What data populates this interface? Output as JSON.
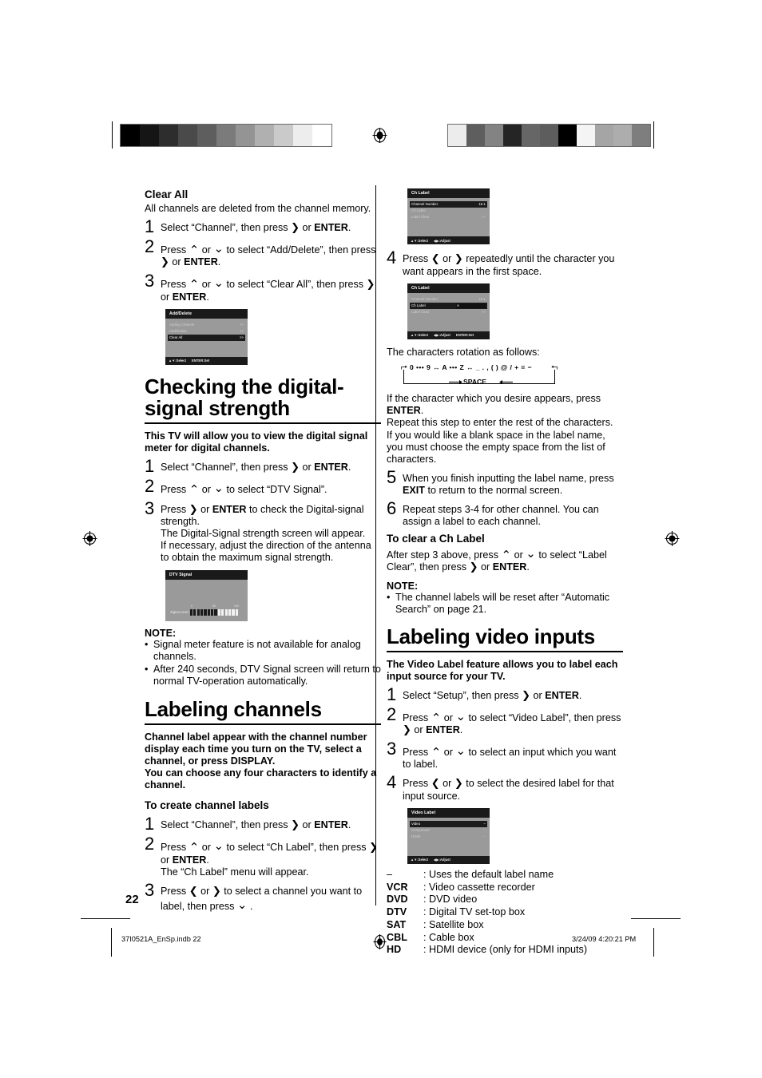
{
  "page": {
    "number": "22",
    "footer_file": "37I0521A_EnSp.indb   22",
    "footer_date": "3/24/09   4:20:21 PM"
  },
  "left_column": {
    "clear_all": {
      "heading": "Clear All",
      "intro": "All channels are deleted from the channel memory.",
      "steps": [
        {
          "num": "1",
          "html": "Select “Channel”, then press <span class=\"gl gl-r\"></span> or <b>ENTER</b>."
        },
        {
          "num": "2",
          "html": "Press <span class=\"gl gl-u\"></span> or <span class=\"gl gl-d\"></span> to select “Add/Delete”, then press <span class=\"gl gl-r\"></span> or <b>ENTER</b>."
        },
        {
          "num": "3",
          "html": "Press <span class=\"gl gl-u\"></span> or <span class=\"gl gl-d\"></span> to select “Clear All”, then press <span class=\"gl gl-r\"></span> or <b>ENTER</b>."
        }
      ],
      "osd": {
        "title": "Add/Delete",
        "rows": [
          {
            "label": "Adding Channel",
            "value": ">>",
            "highlight": false
          },
          {
            "label": "Add/Delete",
            "value": ">>",
            "highlight": false
          },
          {
            "label": "Clear All",
            "value": ">>",
            "highlight": true
          }
        ],
        "footer": [
          "▲▼:Select",
          "ENTER:Set"
        ]
      }
    },
    "signal_section": {
      "title": "Checking the digital-signal strength",
      "intro": "This TV will allow you to view the digital signal meter for digital channels.",
      "steps": [
        {
          "num": "1",
          "html": "Select “Channel”, then press <span class=\"gl gl-r\"></span> or <b>ENTER</b>."
        },
        {
          "num": "2",
          "html": "Press <span class=\"gl gl-u\"></span> or <span class=\"gl gl-d\"></span> to select “DTV Signal”."
        },
        {
          "num": "3",
          "html": "Press <span class=\"gl gl-r\"></span> or <b>ENTER</b> to check the Digital-signal strength.<br>The Digital-Signal strength screen will appear.<br>If necessary, adjust the direction of the antenna to obtain the maximum signal strength."
        }
      ],
      "osd": {
        "title": "DTV Signal",
        "signal_label": "Signal Level",
        "scale": [
          "0",
          "50",
          "100"
        ],
        "bars_total": 14,
        "bars_on": 6
      },
      "note_title": "NOTE:",
      "notes": [
        "Signal meter feature is not available for analog channels.",
        "After 240 seconds, DTV Signal screen will return to normal TV-operation automatically."
      ]
    },
    "labeling_channels": {
      "title": "Labeling channels",
      "intro1": "Channel label appear with the channel number display each time you turn on the TV, select a channel, or press DISPLAY.",
      "intro2": "You can choose any four characters to identify a channel.",
      "sub_heading": "To create channel labels",
      "steps": [
        {
          "num": "1",
          "html": "Select “Channel”, then press <span class=\"gl gl-r\"></span> or <b>ENTER</b>."
        },
        {
          "num": "2",
          "html": "Press <span class=\"gl gl-u\"></span> or <span class=\"gl gl-d\"></span> to select “Ch Label”, then press <span class=\"gl gl-r\"></span> or <b>ENTER</b>.<br>The “Ch Label” menu will appear."
        },
        {
          "num": "3",
          "html": "Press <span class=\"gl gl-l\"></span> or <span class=\"gl gl-r\"></span> to select a channel you want to label, then press <span class=\"gl gl-d\"></span> ."
        }
      ]
    }
  },
  "right_column": {
    "osd_ch_label_1": {
      "title": "Ch Label",
      "rows": [
        {
          "label": "Channel Number",
          "value": "15-1",
          "highlight": true
        },
        {
          "label": "Ch Label",
          "value": "",
          "highlight": false
        },
        {
          "label": "Label Clear",
          "value": ">>",
          "highlight": false
        }
      ],
      "footer": [
        "▲▼:Select",
        "◀▶:Adjust"
      ]
    },
    "step4": {
      "num": "4",
      "html": "Press <span class=\"gl gl-l\"></span> or <span class=\"gl gl-r\"></span> repeatedly until the character you want appears in the first space."
    },
    "osd_ch_label_2": {
      "title": "Ch Label",
      "rows": [
        {
          "label": "Channel Number",
          "value": "15-1",
          "highlight": false
        },
        {
          "label": "Ch Label",
          "value": "A",
          "highlight": true,
          "field": true
        },
        {
          "label": "Label Clear",
          "value": ">>",
          "highlight": false
        }
      ],
      "footer": [
        "▲▼:Select",
        "◀▶:Adjust",
        "ENTER:Set"
      ]
    },
    "rotation_caption": "The characters rotation as follows:",
    "rotation": {
      "line1": "0 ••• 9 ↔ A ••• Z ↔ _ . , ( ) @ / + = −",
      "line2": "SPACE"
    },
    "after_rotation": [
      "If the character which you desire appears, press <b>ENTER</b>.",
      "Repeat this step to enter the rest of the characters.",
      "If you would like a blank space in the label name, you must choose the empty space from the list of characters."
    ],
    "steps_56": [
      {
        "num": "5",
        "html": "When you finish inputting the label name, press <b>EXIT</b> to return to the normal screen."
      },
      {
        "num": "6",
        "html": "Repeat steps 3-4 for other channel. You can assign a label to each channel."
      }
    ],
    "clear_ch_label": {
      "heading": "To clear a Ch Label",
      "text": "After step 3 above, press <span class=\"gl gl-u\"></span> or <span class=\"gl gl-d\"></span> to select “Label Clear”, then press <span class=\"gl gl-r\"></span> or <b>ENTER</b>."
    },
    "note_title": "NOTE:",
    "notes": [
      "The channel labels will be reset after “Automatic Search” on page 21."
    ],
    "labeling_video": {
      "title": "Labeling video inputs",
      "intro": "The Video Label feature allows you to label each input source for your TV.",
      "steps": [
        {
          "num": "1",
          "html": "Select “Setup”, then press <span class=\"gl gl-r\"></span> or <b>ENTER</b>."
        },
        {
          "num": "2",
          "html": "Press <span class=\"gl gl-u\"></span> or <span class=\"gl gl-d\"></span> to select “Video Label”, then press <span class=\"gl gl-r\"></span> or <b>ENTER</b>."
        },
        {
          "num": "3",
          "html": "Press <span class=\"gl gl-u\"></span> or <span class=\"gl gl-d\"></span> to select an input which you want to label."
        },
        {
          "num": "4",
          "html": "Press <span class=\"gl gl-l\"></span> or <span class=\"gl gl-r\"></span> to select the desired label for that input source."
        }
      ],
      "osd": {
        "title": "Video Label",
        "rows": [
          {
            "label": "Video",
            "value": "–",
            "highlight": true
          },
          {
            "label": "Component",
            "value": "–",
            "highlight": false
          },
          {
            "label": "HDMI",
            "value": "–",
            "highlight": false
          }
        ],
        "footer": [
          "▲▼:Select",
          "◀▶:Adjust"
        ]
      },
      "legend": [
        {
          "key": "–",
          "dash": true,
          "value": ": Uses the default label name"
        },
        {
          "key": "VCR",
          "dash": false,
          "value": ": Video cassette recorder"
        },
        {
          "key": "DVD",
          "dash": false,
          "value": ": DVD video"
        },
        {
          "key": "DTV",
          "dash": false,
          "value": ": Digital TV set-top box"
        },
        {
          "key": "SAT",
          "dash": false,
          "value": ": Satellite box"
        },
        {
          "key": "CBL",
          "dash": false,
          "value": ": Cable box"
        },
        {
          "key": "HD",
          "dash": false,
          "value": ": HDMI device (only for HDMI inputs)"
        }
      ]
    }
  },
  "calibration": {
    "left_strip": [
      "#000000",
      "#151515",
      "#2d2d2d",
      "#4a4a4a",
      "#5e5e5e",
      "#7b7b7b",
      "#949494",
      "#b0b0b0",
      "#cacaca",
      "#ededed",
      "#ffffff"
    ],
    "right_strip": [
      "#ececec",
      "#5e5e5e",
      "#838383",
      "#252525",
      "#666666",
      "#5d5d5d",
      "#000000",
      "#f4f4f4",
      "#a5a5a5",
      "#adadad",
      "#7e7e7e"
    ]
  }
}
